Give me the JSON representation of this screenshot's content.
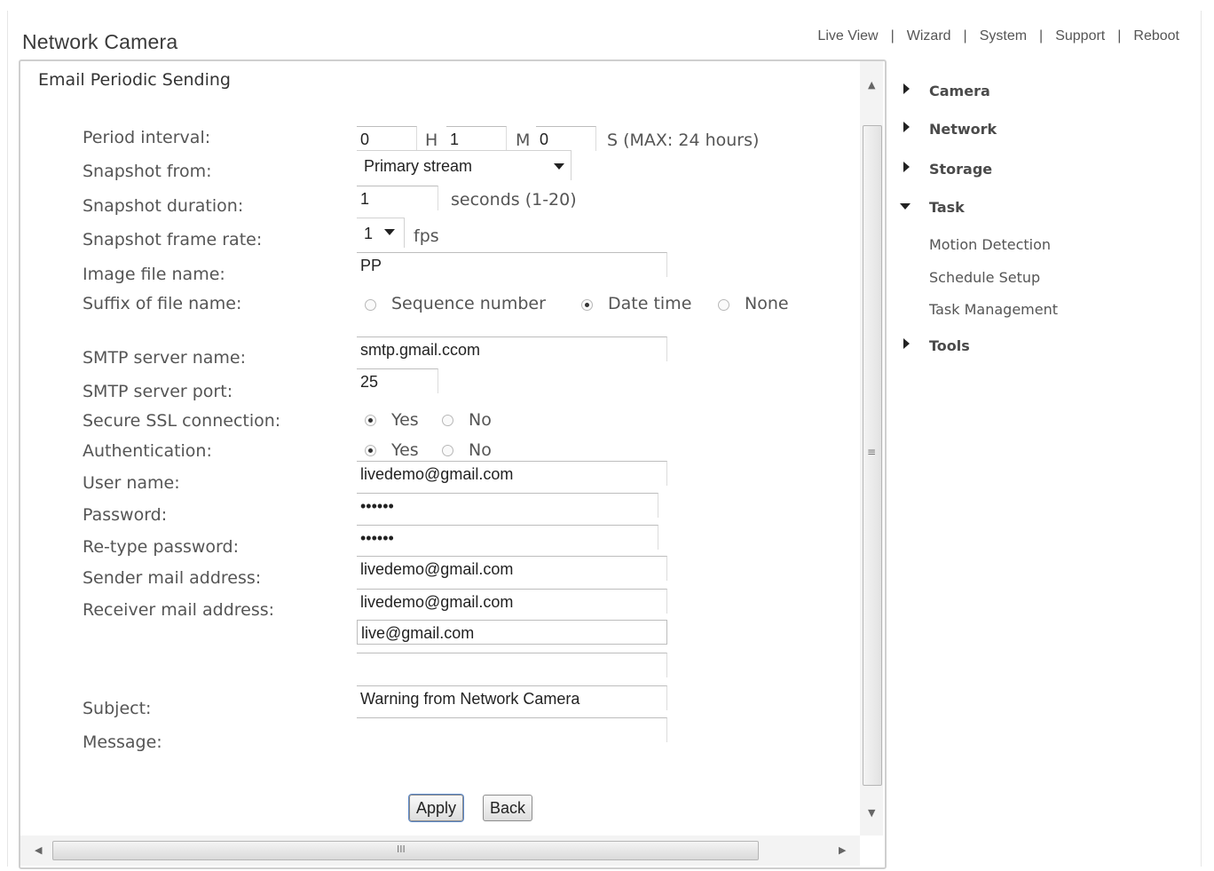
{
  "header": {
    "brand": "Network Camera",
    "nav": [
      "Live View",
      "Wizard",
      "System",
      "Support",
      "Reboot"
    ],
    "separator": "|"
  },
  "page": {
    "title": "Email Periodic Sending"
  },
  "form": {
    "period_interval": {
      "label": "Period interval:",
      "hours": "0",
      "h_unit": "H",
      "minutes": "1",
      "m_unit": "M",
      "seconds": "0",
      "s_unit": "S (MAX: 24 hours)"
    },
    "snapshot_from": {
      "label": "Snapshot from:",
      "value": "Primary stream"
    },
    "snapshot_duration": {
      "label": "Snapshot duration:",
      "value": "1",
      "unit": "seconds (1-20)"
    },
    "snapshot_frame_rate": {
      "label": "Snapshot frame rate:",
      "value": "1",
      "unit": "fps"
    },
    "image_file_name": {
      "label": "Image file name:",
      "value": "PP"
    },
    "suffix": {
      "label": "Suffix of file name:",
      "options": [
        "Sequence number",
        "Date time",
        "None"
      ],
      "selected": "Date time"
    },
    "smtp_server_name": {
      "label": "SMTP server name:",
      "value": "smtp.gmail.ccom"
    },
    "smtp_server_port": {
      "label": "SMTP server port:",
      "value": "25"
    },
    "secure_ssl": {
      "label": "Secure SSL connection:",
      "yes": "Yes",
      "no": "No",
      "selected": "Yes"
    },
    "authentication": {
      "label": "Authentication:",
      "yes": "Yes",
      "no": "No",
      "selected": "Yes"
    },
    "user_name": {
      "label": "User name:",
      "value": "livedemo@gmail.com"
    },
    "password": {
      "label": "Password:",
      "value": "••••••"
    },
    "retype_password": {
      "label": "Re-type password:",
      "value": "••••••"
    },
    "sender_mail": {
      "label": "Sender mail address:",
      "value": "livedemo@gmail.com"
    },
    "receiver_mail": {
      "label": "Receiver mail address:",
      "values": [
        "livedemo@gmail.com",
        "live@gmail.com",
        ""
      ]
    },
    "subject": {
      "label": "Subject:",
      "value": "Warning from Network Camera"
    },
    "message": {
      "label": "Message:",
      "value": ""
    },
    "apply_label": "Apply",
    "back_label": "Back"
  },
  "sidebar": {
    "items": [
      {
        "label": "Camera",
        "expanded": false
      },
      {
        "label": "Network",
        "expanded": false
      },
      {
        "label": "Storage",
        "expanded": false
      },
      {
        "label": "Task",
        "expanded": true,
        "children": [
          "Motion Detection",
          "Schedule Setup",
          "Task Management"
        ]
      },
      {
        "label": "Tools",
        "expanded": false
      }
    ]
  },
  "scrollbar": {
    "grip_glyph": "≡",
    "hgrip_glyph": "III"
  }
}
